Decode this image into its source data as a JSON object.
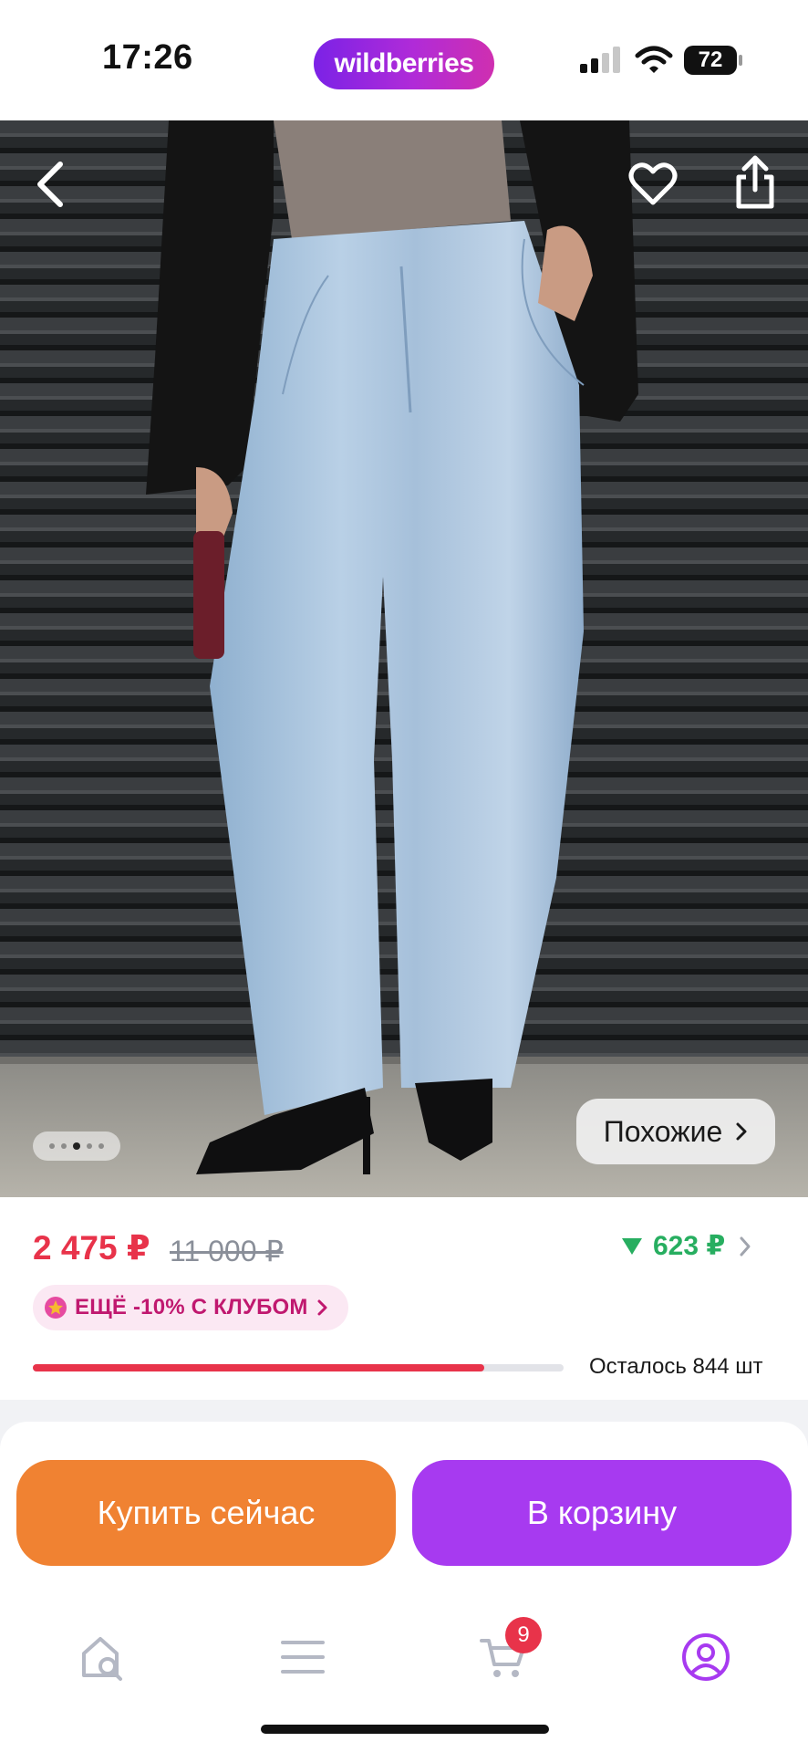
{
  "status_bar": {
    "time": "17:26",
    "brand": "wildberries",
    "battery": "72",
    "icons": [
      "cellular-signal-icon",
      "wifi-icon",
      "battery-icon"
    ]
  },
  "product_gallery": {
    "image_description": "model wearing light-wash wide-leg jeans",
    "slides_total": 5,
    "active_slide": 3,
    "similar_label": "Похожие",
    "icons": [
      "back-arrow-icon",
      "heart-icon",
      "share-icon",
      "chevron-right-icon"
    ]
  },
  "price": {
    "current": "2 475 ₽",
    "old": "11 000 ₽",
    "cashback": "623 ₽",
    "club_offer": "ЕЩЁ -10% С КЛУБОМ",
    "stock_text": "Осталось 844 шт",
    "stock_level": 0.85,
    "colors": {
      "price": "#e8334a",
      "cashback": "#27ae60",
      "club": "#c0186f"
    }
  },
  "actions": {
    "buy_now": "Купить сейчас",
    "add_to_cart": "В корзину",
    "colors": {
      "buy_now": "#f08232",
      "add_to_cart": "#a73af0"
    }
  },
  "tab_bar": {
    "items": [
      {
        "name": "home",
        "icon": "home-search-icon",
        "active": false
      },
      {
        "name": "catalog",
        "icon": "menu-icon",
        "active": false
      },
      {
        "name": "cart",
        "icon": "cart-icon",
        "active": false,
        "badge": "9"
      },
      {
        "name": "profile",
        "icon": "profile-icon",
        "active": true
      }
    ],
    "active_color": "#a73af0"
  }
}
